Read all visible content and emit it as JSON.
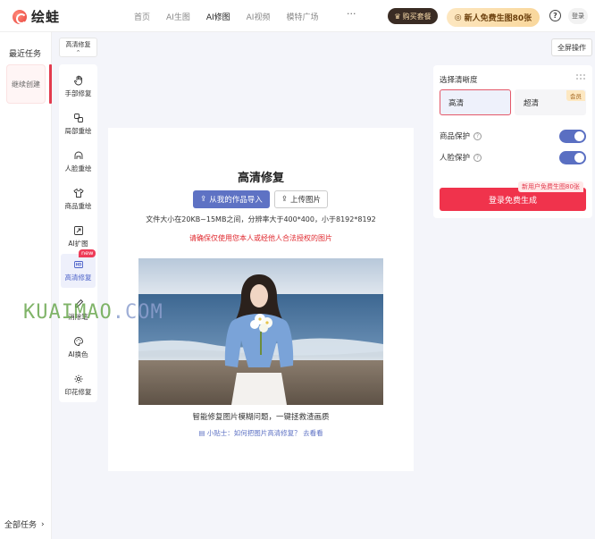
{
  "brand": {
    "name": "绘蛙"
  },
  "nav": {
    "items": [
      "首页",
      "AI生图",
      "AI修图",
      "AI视频",
      "模特广场"
    ],
    "more": "···",
    "buy_package": "购买套餐",
    "free_promo": "新人免费生图80张",
    "help": "?",
    "login": "登录"
  },
  "sidebar": {
    "recent_title": "最近任务",
    "task_label": "继续创建",
    "all_tasks": "全部任务"
  },
  "mode_select": {
    "value": "高清修复"
  },
  "fullscreen": "全屏操作",
  "tools": [
    {
      "label": "手部修复",
      "icon": "hand-icon"
    },
    {
      "label": "局部重绘",
      "icon": "local-repaint-icon"
    },
    {
      "label": "人脸重绘",
      "icon": "face-icon"
    },
    {
      "label": "商品重绘",
      "icon": "shirt-icon"
    },
    {
      "label": "AI扩图",
      "icon": "expand-icon"
    },
    {
      "label": "高清修复",
      "icon": "hd-icon",
      "badge": "new"
    },
    {
      "label": "消除笔",
      "icon": "eraser-pen-icon"
    },
    {
      "label": "AI换色",
      "icon": "palette-icon"
    },
    {
      "label": "印花修复",
      "icon": "print-repair-icon"
    }
  ],
  "canvas": {
    "title": "高清修复",
    "import_button": "从我的作品导入",
    "upload_button": "上传图片",
    "file_limit": "文件大小在20KB~15MB之间，分辨率大于400*400，小于8192*8192",
    "warning": "请确保仅使用您本人或经他人合法授权的图片",
    "caption": "智能修复图片模糊问题，一键拯救渣画质",
    "tip": "小贴士：如何把图片高清修复？ 去看看"
  },
  "watermark": "KUAIMAO.COM",
  "settings": {
    "title": "选择清晰度",
    "options": [
      "高清",
      "超清"
    ],
    "member_tag": "会员",
    "product_protect": "商品保护",
    "face_protect": "人脸保护",
    "product_protect_on": true,
    "face_protect_on": true,
    "promo_tag": "新用户免费生图80张",
    "generate_button": "登录免费生成"
  },
  "colors": {
    "accent": "#5e72c4",
    "primary_red": "#f0334c",
    "warning_red": "#e0282e"
  }
}
